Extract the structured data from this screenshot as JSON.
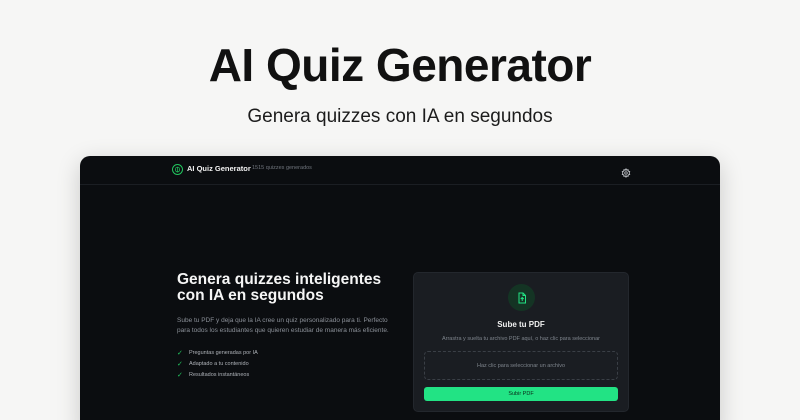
{
  "hero": {
    "title": "AI Quiz Generator",
    "subtitle": "Genera quizzes con IA en segundos"
  },
  "navbar": {
    "brand_name": "AI Quiz Generator",
    "brand_icon": "brain-icon",
    "quiz_count": "1515 quizzes generados",
    "settings_icon": "gear-icon"
  },
  "main": {
    "heading": "Genera quizzes inteligentes con IA en segundos",
    "description": "Sube tu PDF y deja que la IA cree un quiz personalizado para ti. Perfecto para todos los estudiantes que quieren estudiar de manera más eficiente.",
    "features": [
      "Preguntas generadas por IA",
      "Adaptado a tu contenido",
      "Resultados instantáneos"
    ]
  },
  "upload_card": {
    "icon": "file-upload-icon",
    "title": "Sube tu PDF",
    "instructions": "Arrastra y suelta tu archivo PDF aquí, o haz clic para seleccionar",
    "dropzone_text": "Haz clic para seleccionar un archivo",
    "button_label": "Subir PDF"
  },
  "colors": {
    "accent": "#22e384",
    "app_background": "#0b0d10",
    "card_background": "#1a1d22",
    "page_background": "#f6f6f5"
  }
}
